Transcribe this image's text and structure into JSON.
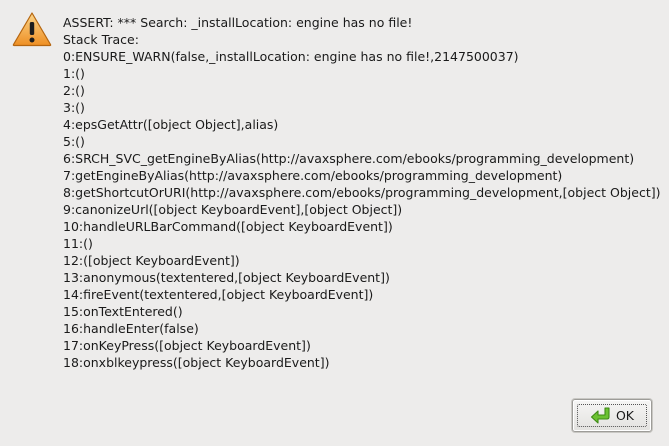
{
  "dialog": {
    "title": "ASSERT: *** Search: _installLocation: engine has no file!",
    "trace_header": "Stack Trace:",
    "trace_lines": [
      "0:ENSURE_WARN(false,_installLocation: engine has no file!,2147500037)",
      "1:()",
      "2:()",
      "3:()",
      "4:epsGetAttr([object Object],alias)",
      "5:()",
      "6:SRCH_SVC_getEngineByAlias(http://avaxsphere.com/ebooks/programming_development)",
      "7:getEngineByAlias(http://avaxsphere.com/ebooks/programming_development)",
      "8:getShortcutOrURI(http://avaxsphere.com/ebooks/programming_development,[object Object])",
      "9:canonizeUrl([object KeyboardEvent],[object Object])",
      "10:handleURLBarCommand([object KeyboardEvent])",
      "11:()",
      "12:([object KeyboardEvent])",
      "13:anonymous(textentered,[object KeyboardEvent])",
      "14:fireEvent(textentered,[object KeyboardEvent])",
      "15:onTextEntered()",
      "16:handleEnter(false)",
      "17:onKeyPress([object KeyboardEvent])",
      "18:onxblkeypress([object KeyboardEvent])"
    ],
    "icon": "warning-icon"
  },
  "buttons": {
    "ok_label": "OK",
    "ok_icon": "ok-arrow-icon"
  },
  "colors": {
    "background": "#edeceb",
    "warning_fill": "#f2a53a",
    "ok_arrow": "#5db52a"
  }
}
